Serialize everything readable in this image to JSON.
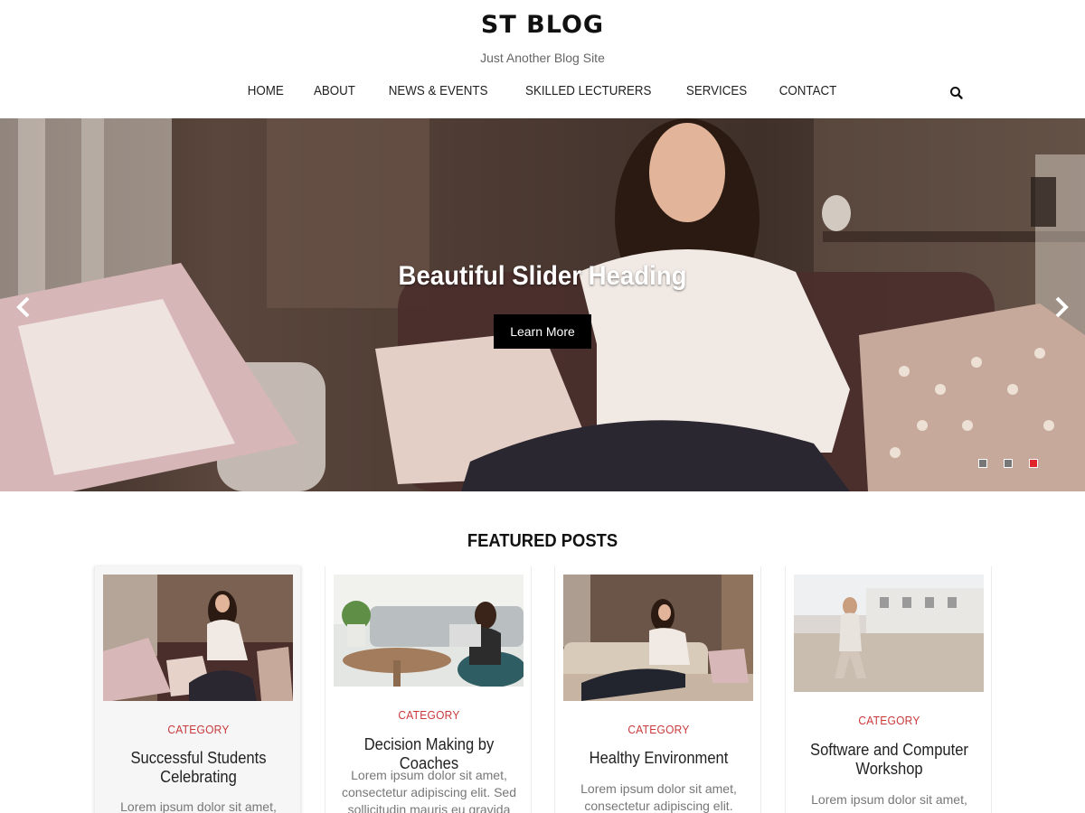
{
  "header": {
    "site_title": "ST BLOG",
    "tagline": "Just Another Blog Site"
  },
  "nav": {
    "items": [
      {
        "label": "HOME"
      },
      {
        "label": "ABOUT"
      },
      {
        "label": "NEWS & EVENTS"
      },
      {
        "label": "SKILLED LECTURERS"
      },
      {
        "label": "SERVICES"
      },
      {
        "label": "CONTACT"
      }
    ],
    "search_icon": "search-icon"
  },
  "slider": {
    "heading": "Beautiful Slider Heading",
    "cta_label": "Learn More",
    "prev_icon": "chevron-left-icon",
    "next_icon": "chevron-right-icon",
    "dot_count": 3,
    "active_dot": 3,
    "active_dot_color": "#e0262a"
  },
  "featured": {
    "title": "FEATURED POSTS",
    "posts": [
      {
        "category": "CATEGORY",
        "title": "Successful Students Celebrating",
        "excerpt": "Lorem ipsum dolor sit amet,"
      },
      {
        "category": "CATEGORY",
        "title": "Decision Making by Coaches",
        "excerpt": "Lorem ipsum dolor sit amet, consectetur adipiscing elit. Sed sollicitudin mauris eu gravida"
      },
      {
        "category": "CATEGORY",
        "title": "Healthy Environment",
        "excerpt": "Lorem ipsum dolor sit amet, consectetur adipiscing elit."
      },
      {
        "category": "CATEGORY",
        "title": "Software and Computer Workshop",
        "excerpt": "Lorem ipsum dolor sit amet,"
      }
    ]
  },
  "colors": {
    "accent": "#c9393b",
    "text": "#222222",
    "cta_bg": "#000000"
  }
}
